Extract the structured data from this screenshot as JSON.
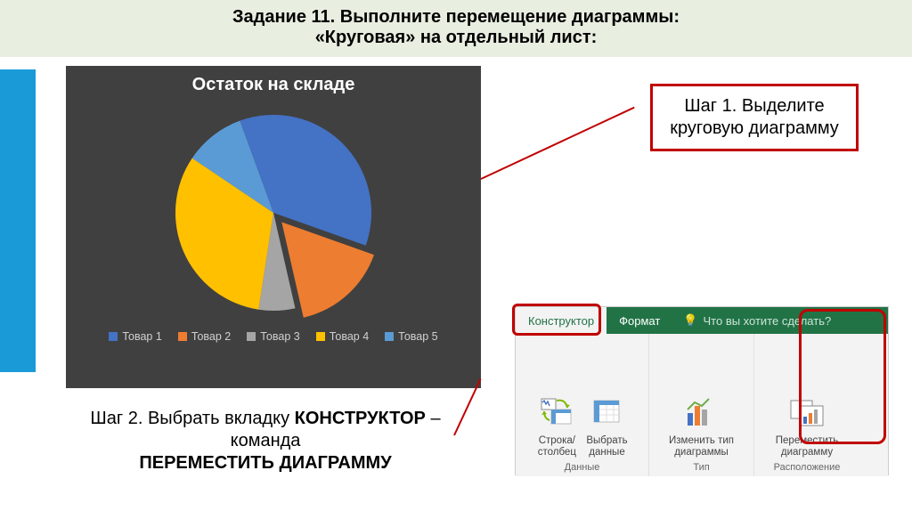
{
  "header": {
    "line1": "Задание 11. Выполните перемещение диаграммы:",
    "line2": "«Круговая» на отдельный лист:"
  },
  "chart_data": {
    "type": "pie",
    "title": "Остаток на складе",
    "categories": [
      "Товар 1",
      "Товар 2",
      "Товар 3",
      "Товар 4",
      "Товар 5"
    ],
    "values": [
      36,
      16,
      6,
      32,
      10
    ],
    "colors": [
      "#4472c4",
      "#ed7d31",
      "#a5a5a5",
      "#ffc000",
      "#5b9bd5"
    ]
  },
  "step1": {
    "prefix": "Шаг 1. ",
    "rest": "Выделите круговую диаграмму"
  },
  "step2": {
    "prefix": "Шаг 2. ",
    "part1": "Выбрать вкладку ",
    "bold1": "КОНСТРУКТОР",
    "part2": " – команда ",
    "bold2": "ПЕРЕМЕСТИТЬ ДИАГРАММУ"
  },
  "ribbon": {
    "tabs": {
      "designer": "Конструктор",
      "format": "Формат"
    },
    "tellme": "Что вы хотите сделать?",
    "buttons": {
      "switchRowCol_l1": "Строка/",
      "switchRowCol_l2": "столбец",
      "selectData_l1": "Выбрать",
      "selectData_l2": "данные",
      "changeType_l1": "Изменить тип",
      "changeType_l2": "диаграммы",
      "moveChart_l1": "Переместить",
      "moveChart_l2": "диаграмму"
    },
    "groups": {
      "data": "Данные",
      "type": "Тип",
      "location": "Расположение"
    }
  }
}
